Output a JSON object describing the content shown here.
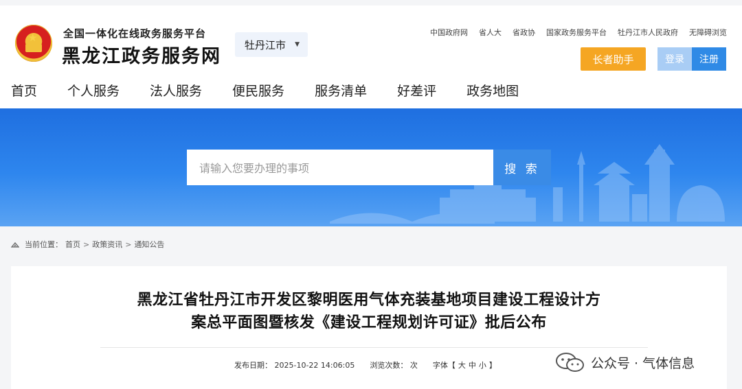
{
  "header": {
    "subtitle": "全国一体化在线政务服务平台",
    "title": "黑龙江政务服务网",
    "city": "牡丹江市",
    "links": [
      "中国政府网",
      "省人大",
      "省政协",
      "国家政务服务平台",
      "牡丹江市人民政府",
      "无障碍浏览"
    ],
    "elder_btn": "长者助手",
    "login": "登录",
    "register": "注册"
  },
  "nav": [
    "首页",
    "个人服务",
    "法人服务",
    "便民服务",
    "服务清单",
    "好差评",
    "政务地图"
  ],
  "search": {
    "placeholder": "请输入您要办理的事项",
    "button": "搜 索"
  },
  "breadcrumb": {
    "label": "当前位置：",
    "items": [
      "首页",
      "政策资讯",
      "通知公告"
    ],
    "sep": ">"
  },
  "article": {
    "title_line1": "黑龙江省牡丹江市开发区黎明医用气体充装基地项目建设工程设计方",
    "title_line2": "案总平面图暨核发《建设工程规划许可证》批后公布",
    "date_label": "发布日期：",
    "date": "2025-10-22 14:06:05",
    "views_label": "浏览次数：",
    "views_unit": "次",
    "font_label": "字体【",
    "font_big": "大",
    "font_mid": "中",
    "font_small": "小",
    "font_end": "】"
  },
  "watermark": "公众号 · 气体信息",
  "colors": {
    "accent_blue": "#2f8ae6",
    "elder_orange": "#f5a623",
    "banner_blue": "#1f6fe0"
  }
}
